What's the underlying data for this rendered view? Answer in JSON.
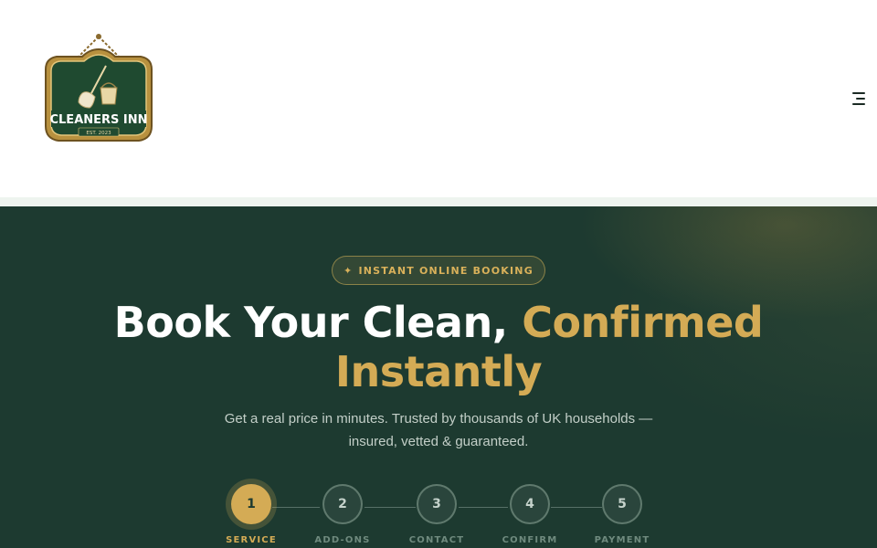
{
  "header": {
    "logo": {
      "name": "CLEANERS INN",
      "est": "EST. 2023"
    },
    "menu_icon": "hamburger-menu-icon"
  },
  "hero": {
    "badge": {
      "icon": "sparkle-icon",
      "spark": "✦",
      "label": "INSTANT ONLINE BOOKING"
    },
    "title": {
      "part1": "Book Your Clean,",
      "part2": "Confirmed",
      "part3": "Instantly"
    },
    "subtitle": "Get a real price in minutes. Trusted by thousands of UK households — insured, vetted & guaranteed."
  },
  "stepper": {
    "current_step": 1,
    "steps": [
      {
        "number": "1",
        "label": "SERVICE"
      },
      {
        "number": "2",
        "label": "ADD-ONS"
      },
      {
        "number": "3",
        "label": "CONTACT"
      },
      {
        "number": "4",
        "label": "CONFIRM"
      },
      {
        "number": "5",
        "label": "PAYMENT"
      }
    ]
  },
  "colors": {
    "hero_bg": "#1d3a30",
    "accent_gold": "#d4ab55",
    "header_bg": "#ffffff"
  }
}
